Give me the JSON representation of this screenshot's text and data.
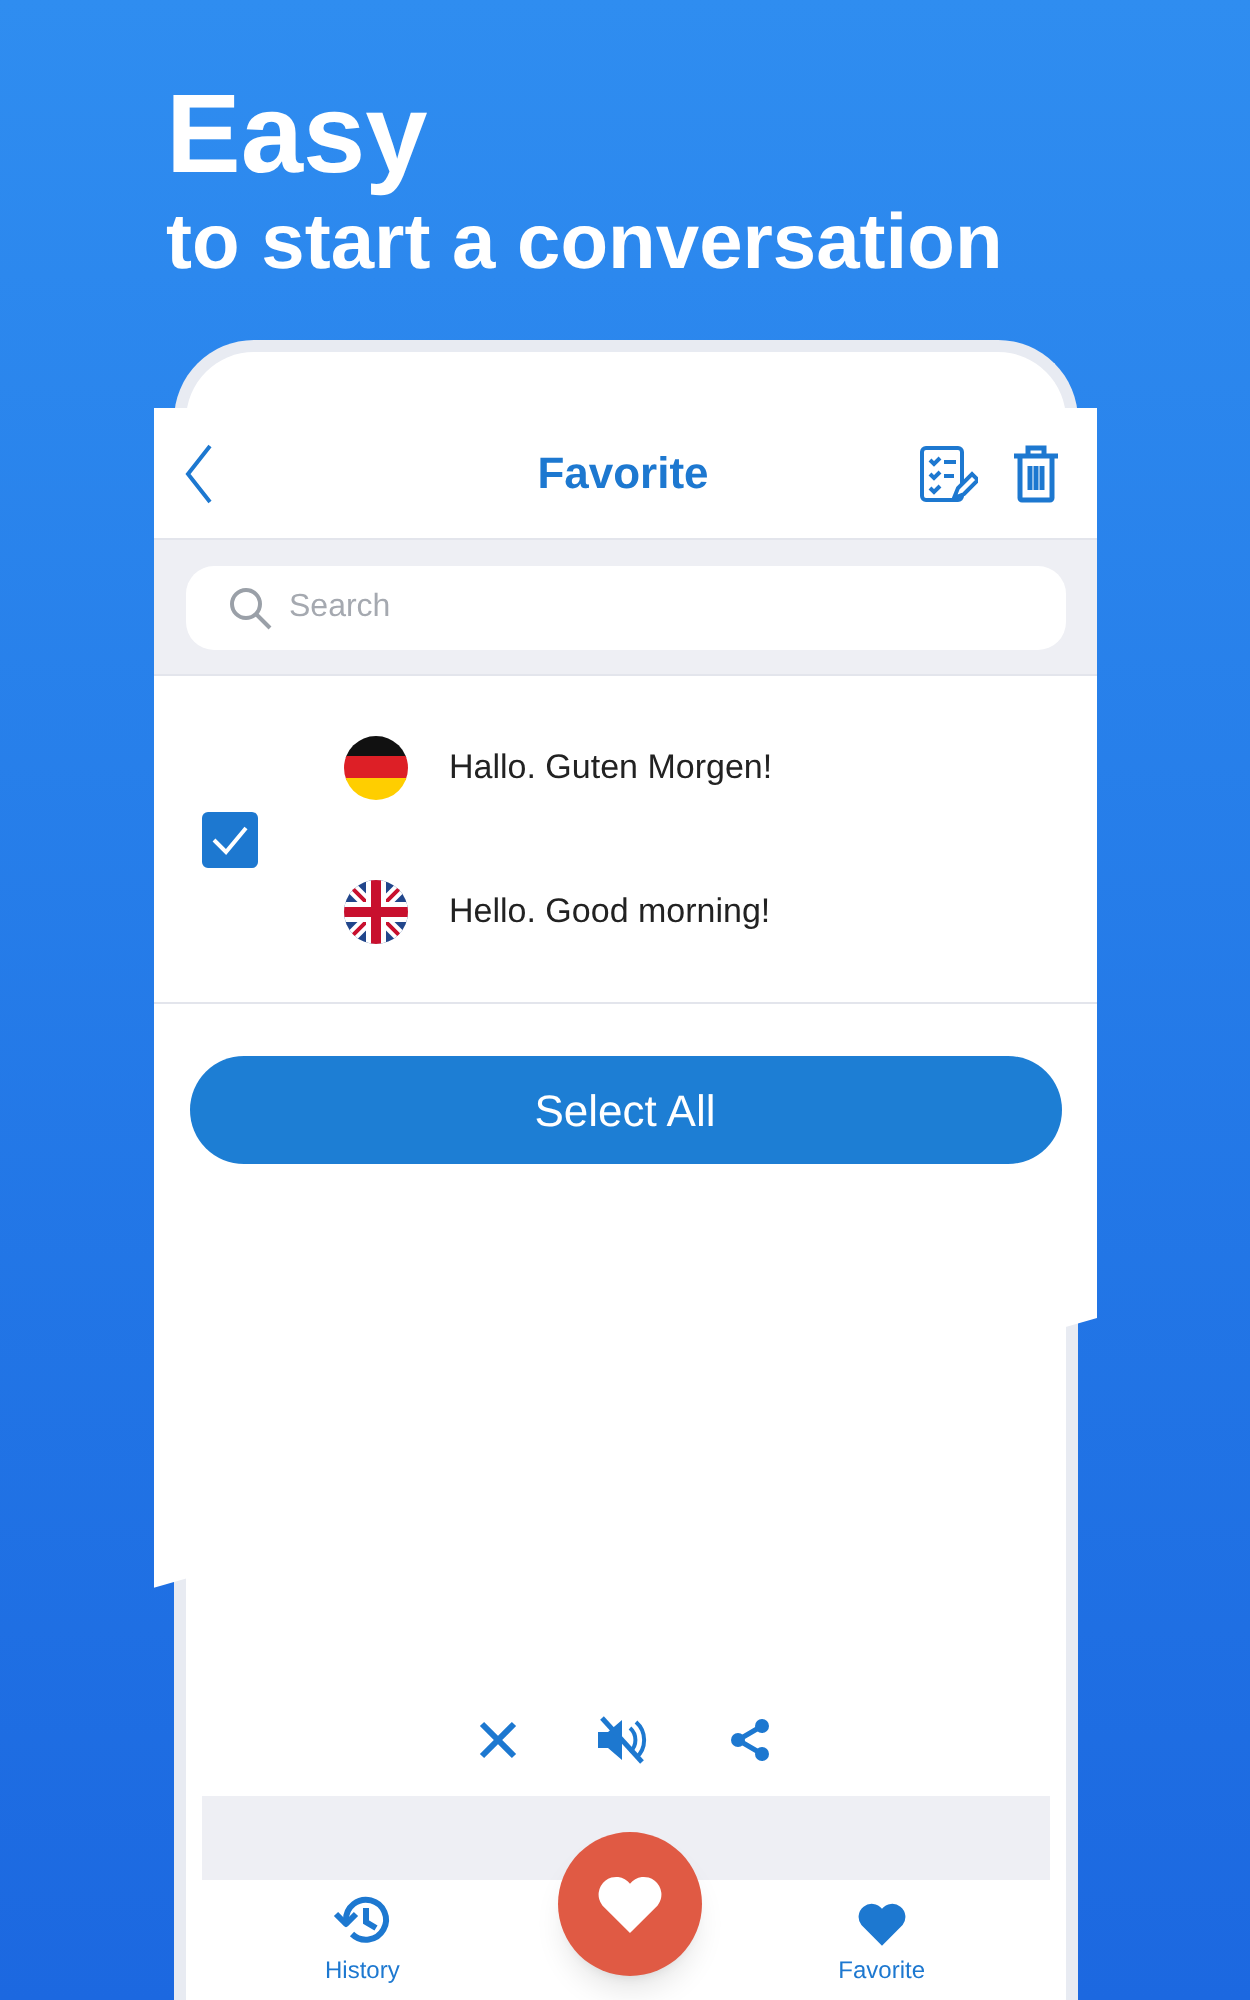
{
  "headline": {
    "title": "Easy",
    "subtitle": "to start a conversation"
  },
  "header": {
    "title": "Favorite"
  },
  "search": {
    "placeholder": "Search"
  },
  "favorites": [
    {
      "checked": true,
      "phrases": [
        {
          "kind": "german",
          "text": "Hallo. Guten Morgen!"
        },
        {
          "kind": "british",
          "text": "Hello. Good morning!"
        }
      ]
    }
  ],
  "select_all_button": "Select All",
  "bottom_nav": [
    {
      "kind": "history",
      "label": "History"
    },
    {
      "kind": "favorite",
      "label": "Favorite"
    }
  ]
}
